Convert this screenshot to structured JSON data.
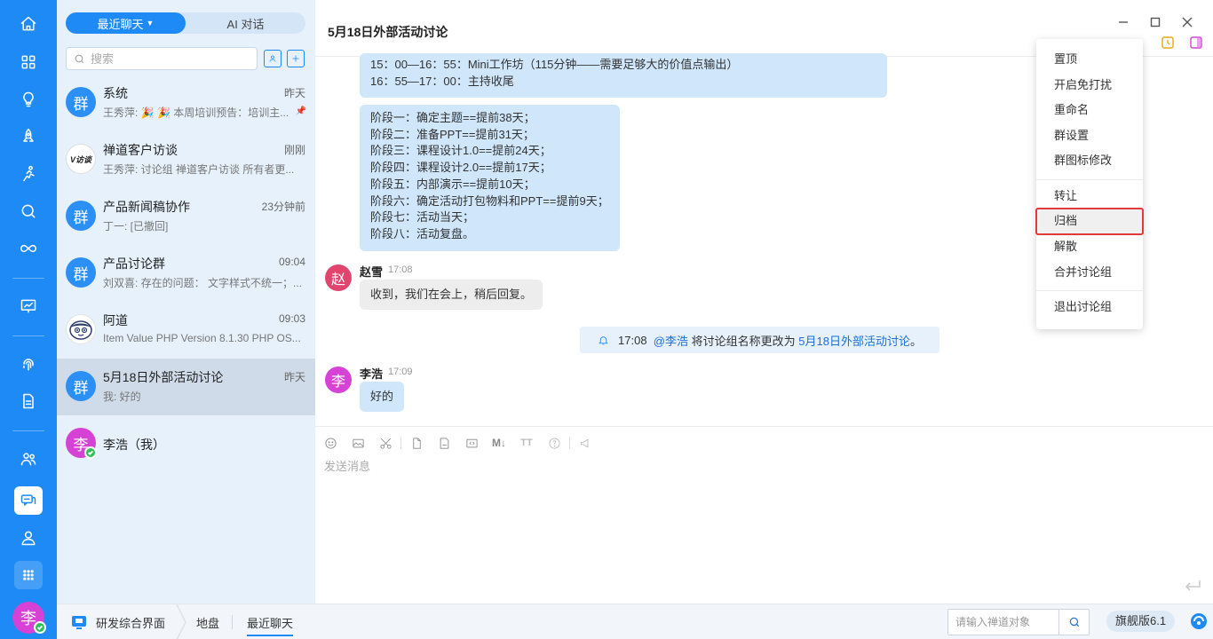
{
  "rail": {
    "items": [
      "home-icon",
      "grid-icon",
      "lightbulb-icon",
      "rocket-icon",
      "run-icon",
      "search-icon",
      "infinity-icon",
      "board-icon",
      "fingerprint-icon",
      "document-icon",
      "team-icon",
      "chat-icon",
      "user-icon",
      "apps-icon"
    ],
    "user_avatar": "李"
  },
  "list": {
    "tabs": {
      "recent": "最近聊天",
      "ai": "AI 对话"
    },
    "search_placeholder": "搜索",
    "conversations": [
      {
        "avatar": "群",
        "name": "系统",
        "time": "昨天",
        "preview": "王秀萍: 🎉 🎉 本周培训预告：培训主...",
        "pinned": true
      },
      {
        "avatar": "V访谈",
        "name": "禅道客户访谈",
        "time": "刚刚",
        "preview": "王秀萍: 讨论组 禅道客户访谈 所有者更..."
      },
      {
        "avatar": "群",
        "name": "产品新闻稿协作",
        "time": "23分钟前",
        "preview": "丁一: [已撤回]"
      },
      {
        "avatar": "群",
        "name": "产品讨论群",
        "time": "09:04",
        "preview": "刘双喜: 存在的问题： 文字样式不统一；..."
      },
      {
        "avatar": "",
        "name": "阿道",
        "time": "09:03",
        "preview": "Item Value PHP Version 8.1.30 PHP OS..."
      },
      {
        "avatar": "群",
        "name": "5月18日外部活动讨论",
        "time": "昨天",
        "preview": "我: 好的"
      },
      {
        "avatar": "李",
        "name": "李浩（我）",
        "time": "",
        "preview": ""
      }
    ]
  },
  "chat": {
    "title": "5月18日外部活动讨论",
    "messages": {
      "agenda_lines": [
        "15：00—16：55：Mini工作坊（115分钟——需要足够大的价值点输出）",
        "16：55—17：00：主持收尾"
      ],
      "phase_lines": [
        "阶段一：确定主题==提前38天；",
        "阶段二：准备PPT==提前31天；",
        "阶段三：课程设计1.0==提前24天；",
        "阶段四：课程设计2.0==提前17天；",
        "阶段五：内部演示==提前10天；",
        "阶段六：确定活动打包物料和PPT==提前9天；",
        "阶段七：活动当天；",
        "阶段八：活动复盘。"
      ],
      "zhao": {
        "avatar": "赵",
        "sender": "赵雪",
        "time": "17:08",
        "text": "收到，我们在会上，稍后回复。"
      },
      "notice": {
        "time": "17:08",
        "mention": "@李浩",
        "middle": "将讨论组名称更改为",
        "new_name": "5月18日外部活动讨论",
        "end": "。"
      },
      "li": {
        "avatar": "李",
        "sender": "李浩",
        "time": "17:09",
        "text": "好的"
      }
    },
    "composer_placeholder": "发送消息"
  },
  "context_menu": {
    "items": [
      "置顶",
      "开启免打扰",
      "重命名",
      "群设置",
      "群图标修改",
      "转让",
      "归档",
      "解散",
      "合并讨论组",
      "退出讨论组"
    ]
  },
  "status_bar": {
    "crumbs": [
      "研发综合界面",
      "地盘",
      "最近聊天"
    ],
    "search_placeholder": "请输入禅道对象",
    "edition": "旗舰版6.1"
  },
  "colors": {
    "primary": "#1d8af5",
    "highlight_border": "#e03a3a",
    "bubble": "#cfe6fb"
  }
}
